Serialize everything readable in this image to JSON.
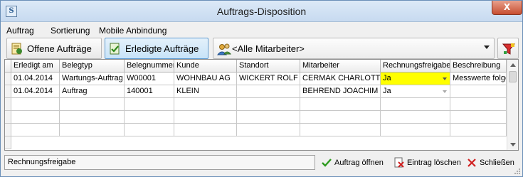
{
  "window": {
    "title": "Auftrags-Disposition",
    "close_label": "X"
  },
  "menu": [
    "Auftrag",
    "Sortierung",
    "Mobile Anbindung"
  ],
  "toolbar": {
    "open_orders_label": "Offene Aufträge",
    "completed_orders_label": "Erledigte Aufträge",
    "employee_filter_value": "<Alle Mitarbeiter>"
  },
  "grid": {
    "columns": [
      "Erledigt am",
      "Belegtyp",
      "Belegnummer",
      "Kunde",
      "Standort",
      "Mitarbeiter",
      "Rechnungsfreigabe",
      "Beschreibung"
    ],
    "rows": [
      [
        "01.04.2014",
        "Wartungs-Auftrag",
        "W00001",
        "WOHNBAU AG",
        "WICKERT ROLF",
        "CERMAK CHARLOTTE",
        "Ja",
        "Messwerte folge"
      ],
      [
        "01.04.2014",
        "Auftrag",
        "140001",
        "KLEIN",
        "",
        "BEHREND JOACHIM",
        "Ja",
        ""
      ]
    ],
    "highlight_color": "#ffff00"
  },
  "status": {
    "text": "Rechnungsfreigabe"
  },
  "footer": {
    "open_label": "Auftrag öffnen",
    "delete_label": "Eintrag löschen",
    "close_label": "Schließen"
  }
}
